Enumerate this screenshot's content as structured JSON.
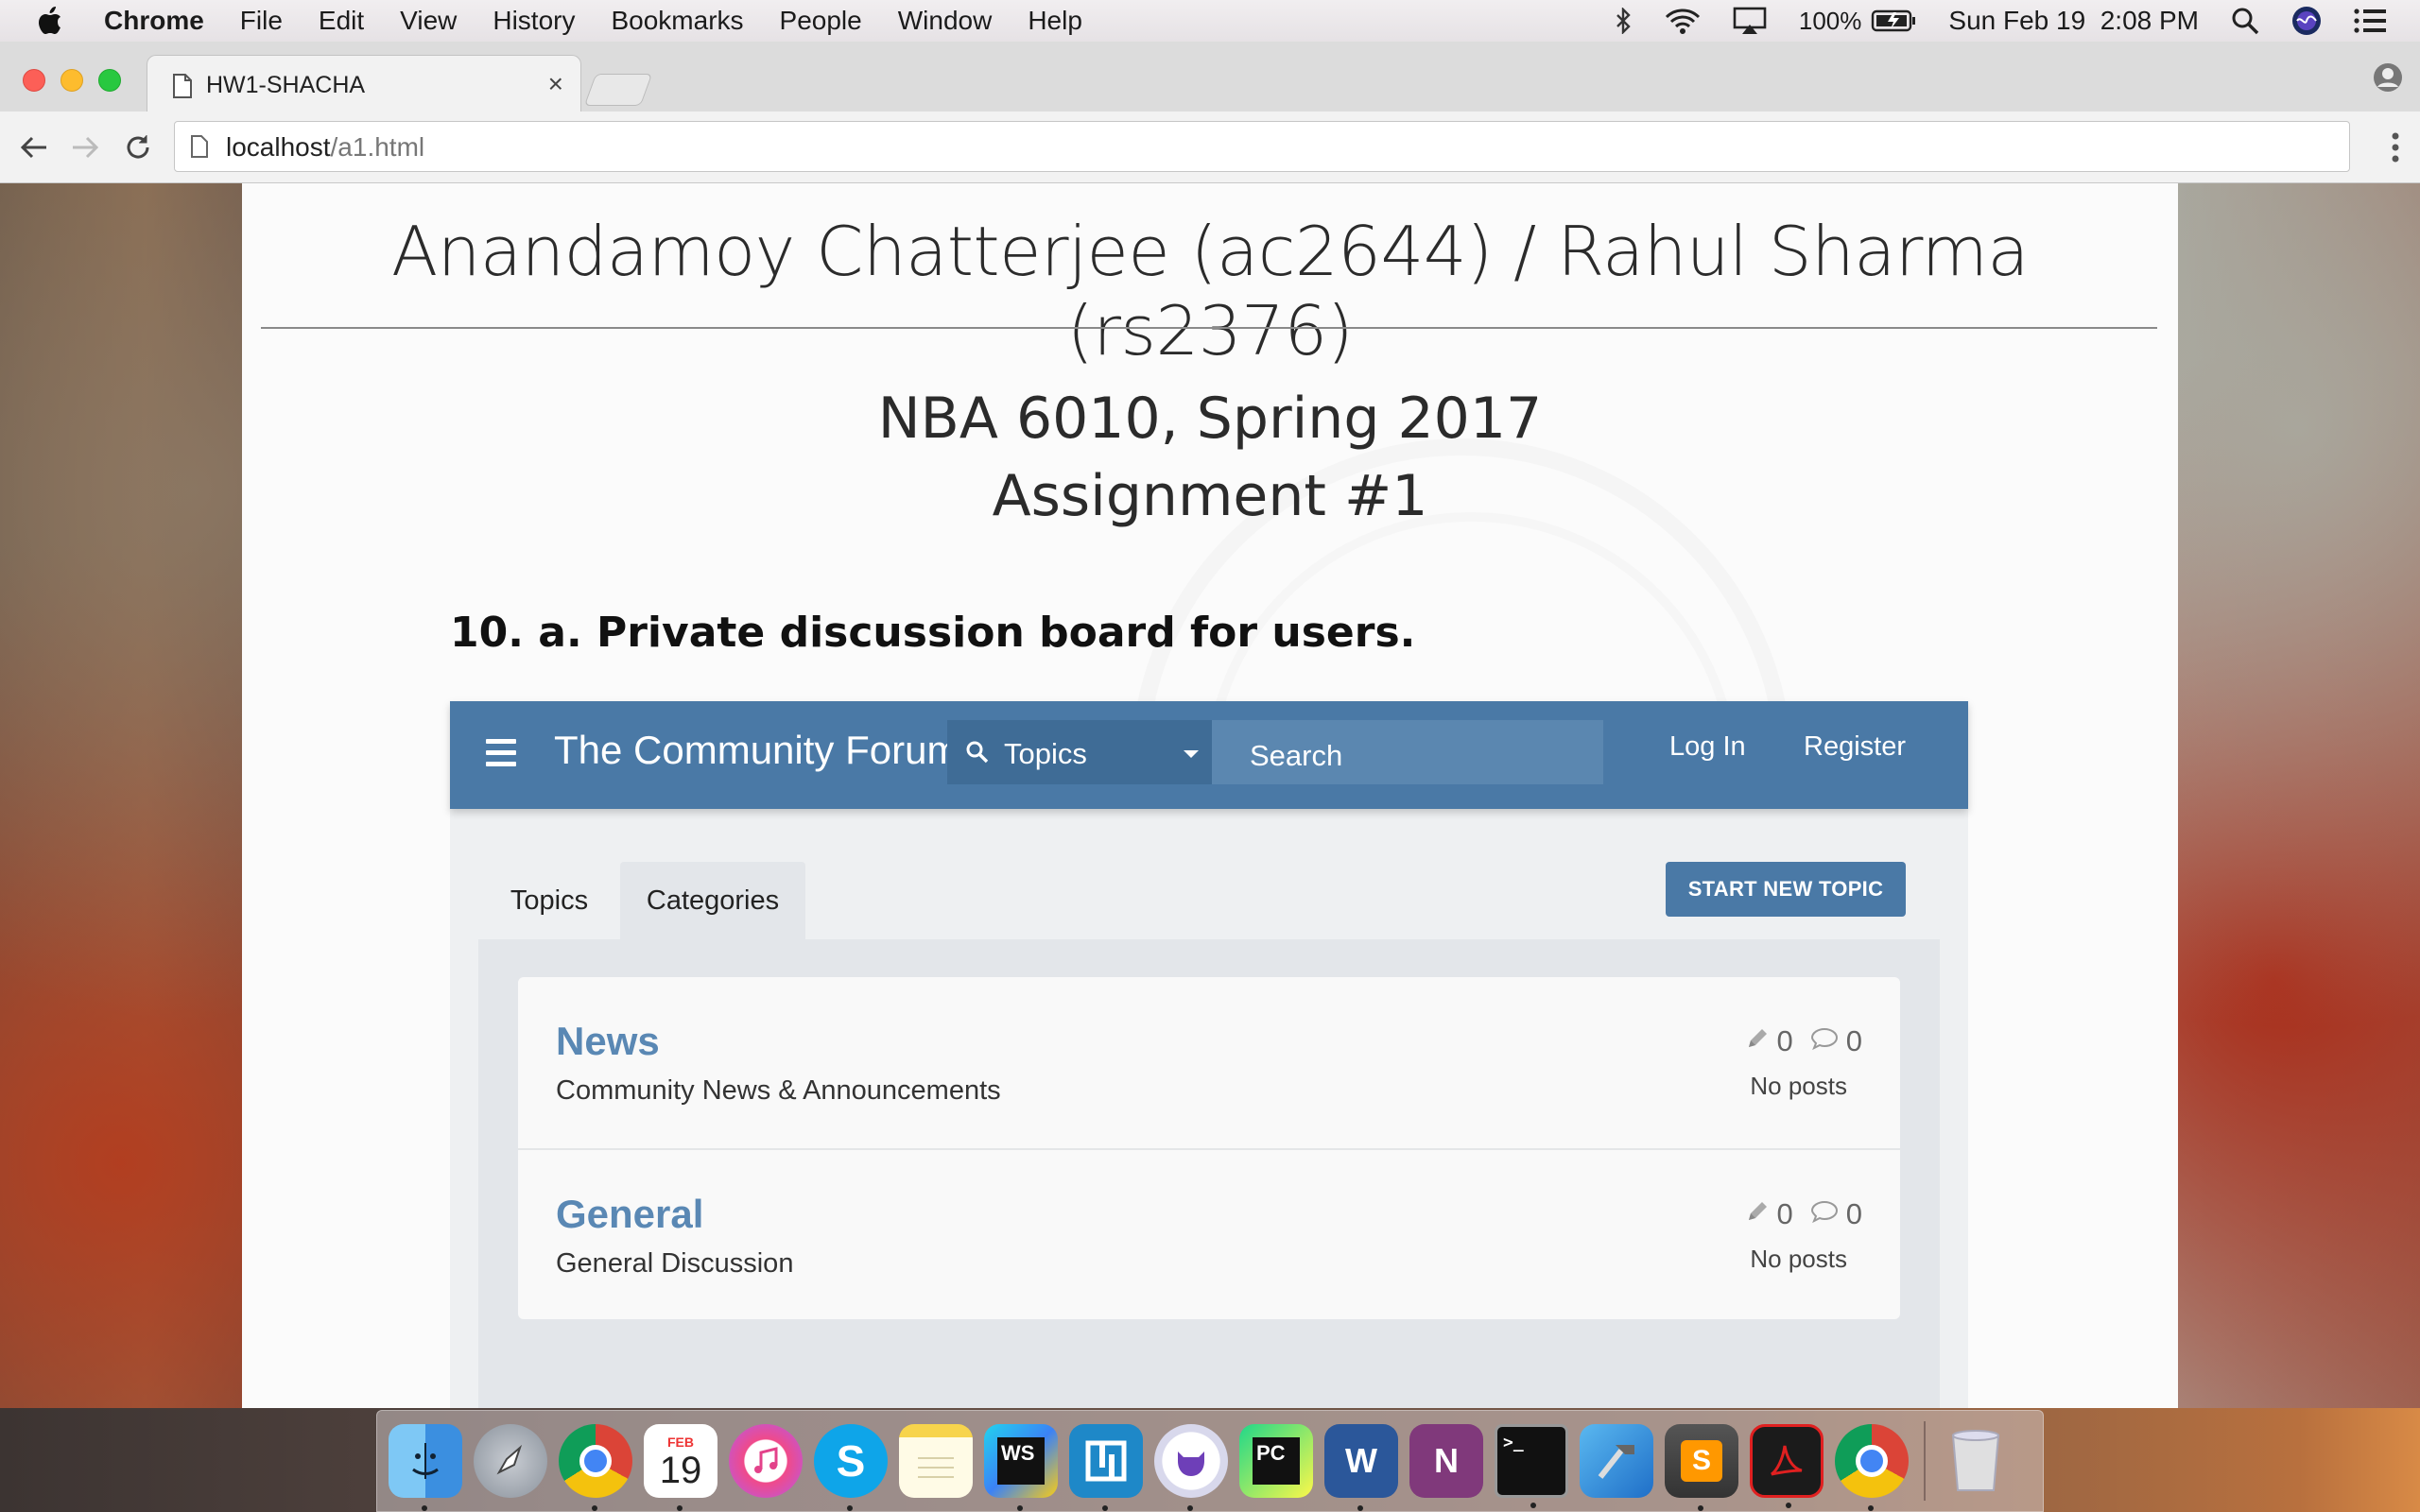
{
  "menubar": {
    "app": "Chrome",
    "items": [
      "File",
      "Edit",
      "View",
      "History",
      "Bookmarks",
      "People",
      "Window",
      "Help"
    ],
    "battery": "100%",
    "clock": "Sun Feb 19  2:08 PM"
  },
  "browser": {
    "tab_title": "HW1-SHACHA",
    "tab_close": "×",
    "url_host": "localhost",
    "url_path": "/a1.html"
  },
  "page": {
    "authors": "Anandamoy Chatterjee (ac2644) / Rahul Sharma (rs2376)",
    "course_line1": "NBA 6010, Spring 2017",
    "course_line2": "Assignment #1",
    "heading": "10. a. Private discussion board for users."
  },
  "forum": {
    "title": "The Community Forum",
    "topics_select": "Topics",
    "search_placeholder": "Search",
    "login": "Log In",
    "register": "Register",
    "tabs": [
      "Topics",
      "Categories"
    ],
    "start_new_topic": "START NEW TOPIC",
    "categories": [
      {
        "name": "News",
        "description": "Community News & Announcements",
        "topics": "0",
        "posts": "0",
        "status": "No posts"
      },
      {
        "name": "General",
        "description": "General Discussion",
        "topics": "0",
        "posts": "0",
        "status": "No posts"
      }
    ]
  },
  "dock": {
    "calendar_month": "FEB",
    "calendar_day": "19",
    "apps": [
      "finder",
      "launchpad",
      "chrome",
      "calendar",
      "itunes",
      "skype",
      "notes",
      "webstorm",
      "parallels",
      "github-desktop",
      "pycharm",
      "word",
      "onenote",
      "terminal",
      "xcode",
      "sublime-text",
      "acrobat",
      "chrome",
      "trash"
    ]
  },
  "colors": {
    "forum_nav": "#4a79a6",
    "category_link": "#5a88b4",
    "start_topic_button": "#4a79a6"
  }
}
